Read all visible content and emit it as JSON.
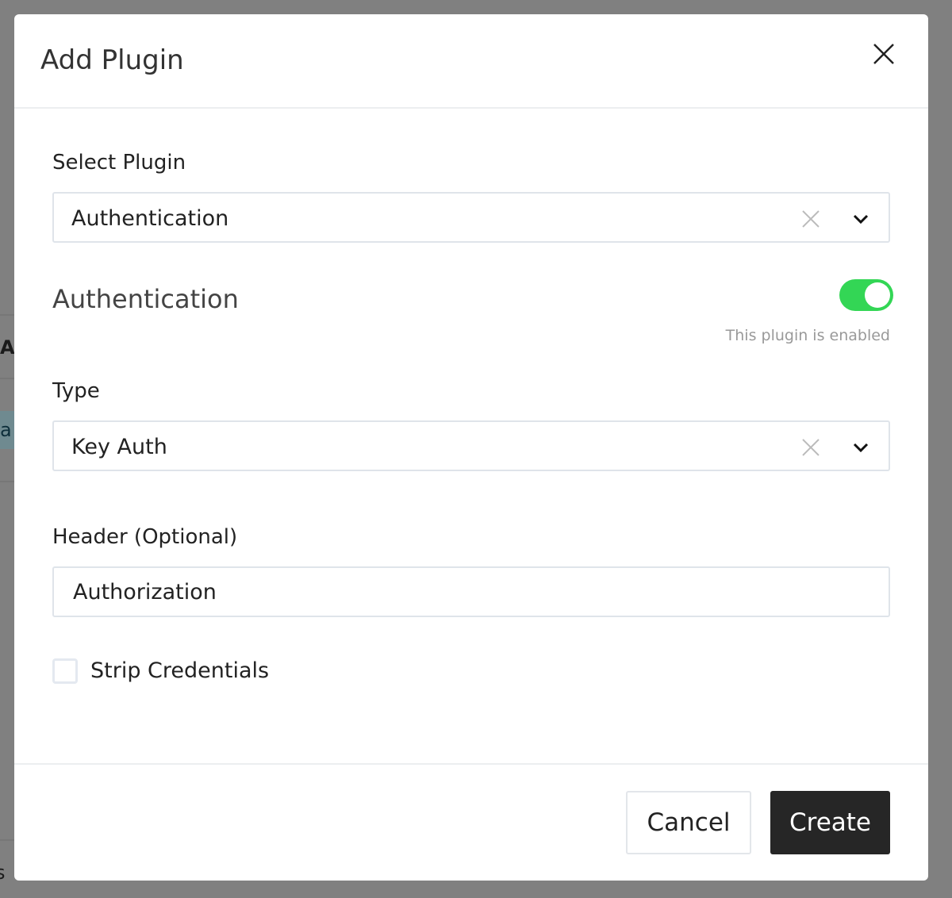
{
  "background": {
    "fragments": [
      "AI",
      "a",
      "s"
    ]
  },
  "modal": {
    "title": "Add Plugin",
    "select_plugin": {
      "label": "Select Plugin",
      "value": "Authentication"
    },
    "section": {
      "title": "Authentication",
      "enabled": true,
      "hint": "This plugin is enabled",
      "toggle_color": "#33d655"
    },
    "type": {
      "label": "Type",
      "value": "Key Auth"
    },
    "header_field": {
      "label": "Header (Optional)",
      "value": "Authorization"
    },
    "strip_credentials": {
      "label": "Strip Credentials",
      "checked": false
    },
    "buttons": {
      "cancel": "Cancel",
      "create": "Create"
    }
  }
}
